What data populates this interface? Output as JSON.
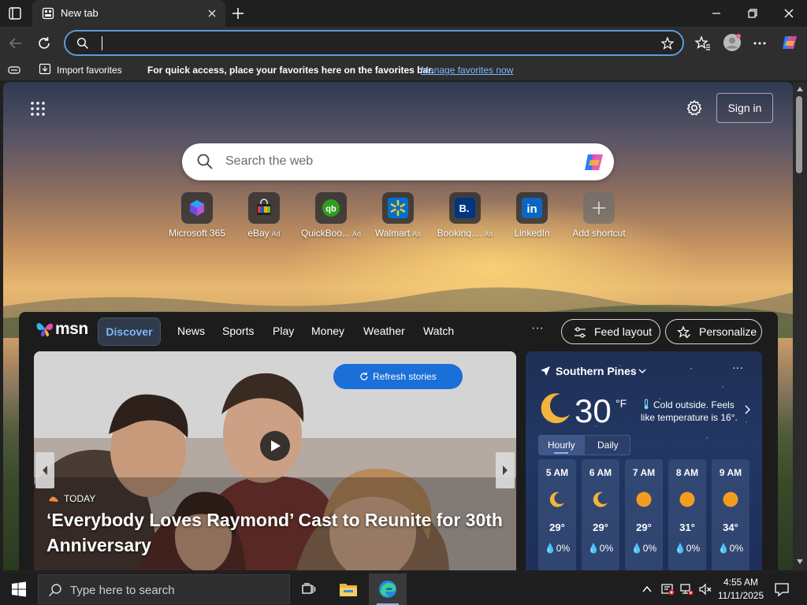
{
  "browser": {
    "tab_title": "New tab",
    "address": {
      "value": "",
      "placeholder": ""
    }
  },
  "favorites_bar": {
    "import_label": "Import favorites",
    "message": "For quick access, place your favorites here on the favorites bar.",
    "manage_link": "Manage favorites now"
  },
  "newtab": {
    "sign_in_label": "Sign in",
    "search_placeholder": "Search the web",
    "shortcuts": [
      {
        "label": "Microsoft 365",
        "ad": "",
        "icon": "microsoft-365-icon",
        "color": "#3a3a3a"
      },
      {
        "label": "eBay",
        "ad": "Ad",
        "icon": "ebay-icon",
        "color": "#3a3a3a"
      },
      {
        "label": "QuickBoo...",
        "ad": "Ad",
        "icon": "quickbooks-icon",
        "color": "#2ca01c"
      },
      {
        "label": "Walmart",
        "ad": "Ad",
        "icon": "walmart-icon",
        "color": "#0071ce"
      },
      {
        "label": "Bookinq....",
        "ad": "Ad",
        "icon": "booking-icon",
        "color": "#003580"
      },
      {
        "label": "LinkedIn",
        "ad": "",
        "icon": "linkedin-icon",
        "color": "#0a66c2"
      },
      {
        "label": "Add shortcut",
        "ad": "",
        "icon": "plus-icon",
        "color": "#4a4a4a"
      }
    ]
  },
  "feed": {
    "logo_text": "msn",
    "nav": [
      "Discover",
      "News",
      "Sports",
      "Play",
      "Money",
      "Weather",
      "Watch"
    ],
    "more": "···",
    "feed_layout_label": "Feed layout",
    "personalize_label": "Personalize",
    "hero": {
      "refresh_label": "Refresh stories",
      "tag": "TODAY",
      "title": "‘Everybody Loves Raymond’ Cast to Reunite for 30th Anniversary"
    },
    "weather": {
      "location": "Southern Pines",
      "more": "···",
      "temperature": "30",
      "unit": "°F",
      "note": "Cold outside. Feels like temperature is 16°.",
      "tabs": [
        "Hourly",
        "Daily"
      ],
      "hours": [
        {
          "time": "5 AM",
          "temp": "29°",
          "precip": "0%",
          "icon": "moon-icon"
        },
        {
          "time": "6 AM",
          "temp": "29°",
          "precip": "0%",
          "icon": "moon-icon"
        },
        {
          "time": "7 AM",
          "temp": "29°",
          "precip": "0%",
          "icon": "sun-icon"
        },
        {
          "time": "8 AM",
          "temp": "31°",
          "precip": "0%",
          "icon": "sun-icon"
        },
        {
          "time": "9 AM",
          "temp": "34°",
          "precip": "0%",
          "icon": "sun-icon"
        }
      ]
    }
  },
  "taskbar": {
    "search_placeholder": "Type here to search",
    "time": "4:55 AM",
    "date": "11/11/2025"
  },
  "colors": {
    "accent": "#1a6fd8",
    "link": "#7cb7ff",
    "panel": "#1c1c1c"
  }
}
